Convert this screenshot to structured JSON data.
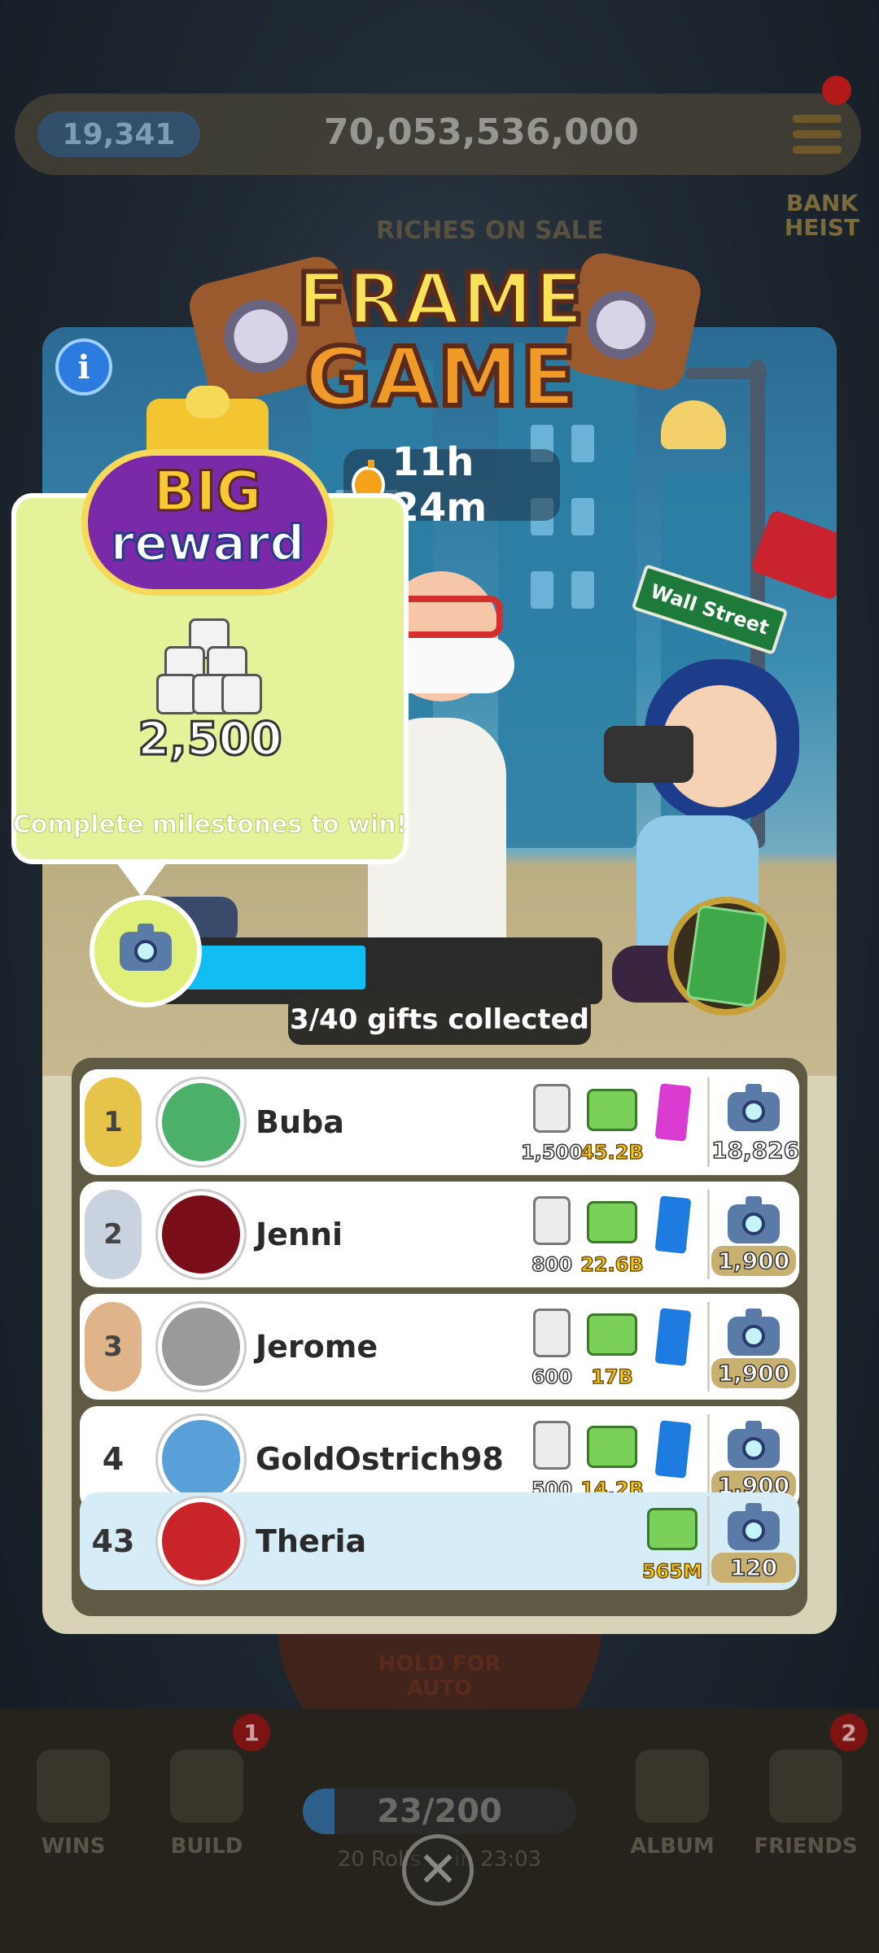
{
  "hud": {
    "rolls": "19,341",
    "cash": "70,053,536,000",
    "bank_heist": "BANK HEIST",
    "riches_on_sale": "RICHES ON SALE"
  },
  "event": {
    "title_line1": "FRAME",
    "title_line2": "GAME",
    "timer": "11h 24m",
    "street_sign": "Wall Street",
    "info_icon": "i"
  },
  "big_reward": {
    "badge_line1": "BIG",
    "badge_line2": "reward",
    "amount": "2,500",
    "note": "Complete milestones to win!"
  },
  "progress": {
    "collected": 3,
    "total": 40,
    "label": "3/40 gifts collected"
  },
  "leaderboard": {
    "rows": [
      {
        "rank": "1",
        "name": "Buba",
        "dice": "1,500",
        "cash": "45.2B",
        "sticker_color": "#d93ad0",
        "score": "18,826"
      },
      {
        "rank": "2",
        "name": "Jenni",
        "dice": "800",
        "cash": "22.6B",
        "sticker_color": "#1e7ce0",
        "score": "1,900"
      },
      {
        "rank": "3",
        "name": "Jerome",
        "dice": "600",
        "cash": "17B",
        "sticker_color": "#1e7ce0",
        "score": "1,900"
      },
      {
        "rank": "4",
        "name": "GoldOstrich98",
        "dice": "500",
        "cash": "14.2B",
        "sticker_color": "#1e7ce0",
        "score": "1,900"
      }
    ],
    "me": {
      "rank": "43",
      "name": "Theria",
      "cash": "565M",
      "score": "120"
    }
  },
  "bottom_nav": {
    "wins": "WINS",
    "build": "BUILD",
    "build_badge": "1",
    "album": "ALBUM",
    "friends": "FRIENDS",
    "friends_badge": "2",
    "roll_meter": "23/200",
    "roll_meter_fill": 0.115,
    "roll_note": "20 Rolls ... in 23:03",
    "hold_for_auto": "HOLD FOR AUTO"
  },
  "colors": {
    "progress": "#11bdf2",
    "gold_rank": "#e6c44a",
    "silver_rank": "#c9d3e0",
    "bronze_rank": "#e0b48a"
  }
}
